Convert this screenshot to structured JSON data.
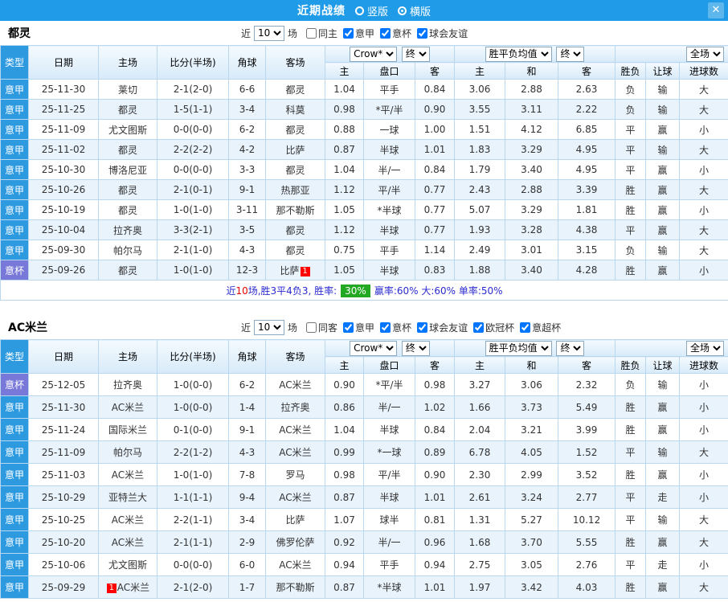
{
  "titlebar": {
    "title": "近期战绩",
    "vertical_label": "竖版",
    "horizontal_label": "横版",
    "selected_layout": "横版",
    "close_label": "✕"
  },
  "colors": {
    "titlebar_bg": "#1f9be7",
    "league_serie_a": "#2d9ae0",
    "league_cup": "#7878d8",
    "focus_team": "#009933",
    "win": "#e60000",
    "draw": "#2952cc",
    "loss": "#009933",
    "win_rate_badge_bg": "#22a822"
  },
  "sections": [
    {
      "team": "都灵",
      "near_label": "近",
      "count_value": "10",
      "games_label": "场",
      "filters": [
        {
          "label": "同主",
          "checked": false
        },
        {
          "label": "意甲",
          "checked": true
        },
        {
          "label": "意杯",
          "checked": true
        },
        {
          "label": "球会友谊",
          "checked": true
        }
      ],
      "header": {
        "type": "类型",
        "date": "日期",
        "home": "主场",
        "score": "比分(半场)",
        "corner": "角球",
        "away": "客场",
        "asia_select": "Crow*",
        "asia_final": "终",
        "asia_home": "主",
        "asia_handicap": "盘口",
        "asia_away": "客",
        "europe_select": "胜平负均值",
        "europe_final": "终",
        "europe_home": "主",
        "europe_draw": "和",
        "europe_away": "客",
        "scope_select": "全场",
        "wdl": "胜负",
        "handicap_result": "让球",
        "goals": "进球数"
      },
      "rows": [
        {
          "league": "意甲",
          "lgc": "jia",
          "date": "25-11-30",
          "home": "莱切",
          "hf": false,
          "score": "2-1(2-0)",
          "corner": "6-6",
          "away": "都灵",
          "af": true,
          "a1": "1.04",
          "hc": "平手",
          "hcr": false,
          "a3": "0.84",
          "e1": "3.06",
          "e2": "2.88",
          "e3": "2.63",
          "r1": "负",
          "c1": "g",
          "r2": "输",
          "c2": "g",
          "r3": "大",
          "c3": "r"
        },
        {
          "league": "意甲",
          "lgc": "jia",
          "date": "25-11-25",
          "home": "都灵",
          "hf": true,
          "score": "1-5(1-1)",
          "corner": "3-4",
          "away": "科莫",
          "af": false,
          "a1": "0.98",
          "hc": "*平/半",
          "hcr": true,
          "a3": "0.90",
          "e1": "3.55",
          "e2": "3.11",
          "e3": "2.22",
          "r1": "负",
          "c1": "g",
          "r2": "输",
          "c2": "g",
          "r3": "大",
          "c3": "r"
        },
        {
          "league": "意甲",
          "lgc": "jia",
          "date": "25-11-09",
          "home": "尤文图斯",
          "hf": false,
          "score": "0-0(0-0)",
          "corner": "6-2",
          "away": "都灵",
          "af": true,
          "a1": "0.88",
          "hc": "一球",
          "hcr": false,
          "a3": "1.00",
          "e1": "1.51",
          "e2": "4.12",
          "e3": "6.85",
          "r1": "平",
          "c1": "b",
          "r2": "赢",
          "c2": "r",
          "r3": "小",
          "c3": "b"
        },
        {
          "league": "意甲",
          "lgc": "jia",
          "date": "25-11-02",
          "home": "都灵",
          "hf": true,
          "score": "2-2(2-2)",
          "corner": "4-2",
          "away": "比萨",
          "af": false,
          "a1": "0.87",
          "hc": "半球",
          "hcr": false,
          "a3": "1.01",
          "e1": "1.83",
          "e2": "3.29",
          "e3": "4.95",
          "r1": "平",
          "c1": "b",
          "r2": "输",
          "c2": "g",
          "r3": "大",
          "c3": "r"
        },
        {
          "league": "意甲",
          "lgc": "jia",
          "date": "25-10-30",
          "home": "博洛尼亚",
          "hf": false,
          "score": "0-0(0-0)",
          "corner": "3-3",
          "away": "都灵",
          "af": true,
          "a1": "1.04",
          "hc": "半/一",
          "hcr": false,
          "a3": "0.84",
          "e1": "1.79",
          "e2": "3.40",
          "e3": "4.95",
          "r1": "平",
          "c1": "b",
          "r2": "赢",
          "c2": "r",
          "r3": "小",
          "c3": "b"
        },
        {
          "league": "意甲",
          "lgc": "jia",
          "date": "25-10-26",
          "home": "都灵",
          "hf": true,
          "score": "2-1(0-1)",
          "corner": "9-1",
          "away": "热那亚",
          "af": false,
          "a1": "1.12",
          "hc": "平/半",
          "hcr": false,
          "a3": "0.77",
          "e1": "2.43",
          "e2": "2.88",
          "e3": "3.39",
          "r1": "胜",
          "c1": "r",
          "r2": "赢",
          "c2": "r",
          "r3": "大",
          "c3": "r"
        },
        {
          "league": "意甲",
          "lgc": "jia",
          "date": "25-10-19",
          "home": "都灵",
          "hf": true,
          "score": "1-0(1-0)",
          "corner": "3-11",
          "away": "那不勒斯",
          "af": false,
          "a1": "1.05",
          "hc": "*半球",
          "hcr": true,
          "a3": "0.77",
          "e1": "5.07",
          "e2": "3.29",
          "e3": "1.81",
          "r1": "胜",
          "c1": "r",
          "r2": "赢",
          "c2": "r",
          "r3": "小",
          "c3": "b"
        },
        {
          "league": "意甲",
          "lgc": "jia",
          "date": "25-10-04",
          "home": "拉齐奥",
          "hf": false,
          "score": "3-3(2-1)",
          "corner": "3-5",
          "away": "都灵",
          "af": true,
          "a1": "1.12",
          "hc": "半球",
          "hcr": false,
          "a3": "0.77",
          "e1": "1.93",
          "e2": "3.28",
          "e3": "4.38",
          "r1": "平",
          "c1": "b",
          "r2": "赢",
          "c2": "r",
          "r3": "大",
          "c3": "r"
        },
        {
          "league": "意甲",
          "lgc": "jia",
          "date": "25-09-30",
          "home": "帕尔马",
          "hf": false,
          "score": "2-1(1-0)",
          "corner": "4-3",
          "away": "都灵",
          "af": true,
          "a1": "0.75",
          "hc": "平手",
          "hcr": false,
          "a3": "1.14",
          "e1": "2.49",
          "e2": "3.01",
          "e3": "3.15",
          "r1": "负",
          "c1": "g",
          "r2": "输",
          "c2": "g",
          "r3": "大",
          "c3": "r"
        },
        {
          "league": "意杯",
          "lgc": "bei",
          "date": "25-09-26",
          "home": "都灵",
          "hf": true,
          "score": "1-0(1-0)",
          "corner": "12-3",
          "away": "比萨",
          "af": false,
          "ab": "1",
          "abp": "after",
          "a1": "1.05",
          "hc": "半球",
          "hcr": false,
          "a3": "0.83",
          "e1": "1.88",
          "e2": "3.40",
          "e3": "4.28",
          "r1": "胜",
          "c1": "r",
          "r2": "赢",
          "c2": "r",
          "r3": "小",
          "c3": "b"
        }
      ],
      "summary": {
        "p1": "近",
        "n": "10",
        "p2": "场,胜3平4负3, 胜率:",
        "win_rate": "30%",
        "p3": "赢率:60% 大:60% 单率:50%"
      }
    },
    {
      "team": "AC米兰",
      "near_label": "近",
      "count_value": "10",
      "games_label": "场",
      "filters": [
        {
          "label": "同客",
          "checked": false
        },
        {
          "label": "意甲",
          "checked": true
        },
        {
          "label": "意杯",
          "checked": true
        },
        {
          "label": "球会友谊",
          "checked": true
        },
        {
          "label": "欧冠杯",
          "checked": true
        },
        {
          "label": "意超杯",
          "checked": true
        }
      ],
      "header": {
        "type": "类型",
        "date": "日期",
        "home": "主场",
        "score": "比分(半场)",
        "corner": "角球",
        "away": "客场",
        "asia_select": "Crow*",
        "asia_final": "终",
        "asia_home": "主",
        "asia_handicap": "盘口",
        "asia_away": "客",
        "europe_select": "胜平负均值",
        "europe_final": "终",
        "europe_home": "主",
        "europe_draw": "和",
        "europe_away": "客",
        "scope_select": "全场",
        "wdl": "胜负",
        "handicap_result": "让球",
        "goals": "进球数"
      },
      "rows": [
        {
          "league": "意杯",
          "lgc": "bei",
          "date": "25-12-05",
          "home": "拉齐奥",
          "hf": false,
          "score": "1-0(0-0)",
          "corner": "6-2",
          "away": "AC米兰",
          "af": true,
          "a1": "0.90",
          "hc": "*平/半",
          "hcr": true,
          "a3": "0.98",
          "e1": "3.27",
          "e2": "3.06",
          "e3": "2.32",
          "r1": "负",
          "c1": "g",
          "r2": "输",
          "c2": "g",
          "r3": "小",
          "c3": "b"
        },
        {
          "league": "意甲",
          "lgc": "jia",
          "date": "25-11-30",
          "home": "AC米兰",
          "hf": true,
          "score": "1-0(0-0)",
          "corner": "1-4",
          "away": "拉齐奥",
          "af": false,
          "a1": "0.86",
          "hc": "半/一",
          "hcr": false,
          "a3": "1.02",
          "e1": "1.66",
          "e2": "3.73",
          "e3": "5.49",
          "r1": "胜",
          "c1": "r",
          "r2": "赢",
          "c2": "r",
          "r3": "小",
          "c3": "b"
        },
        {
          "league": "意甲",
          "lgc": "jia",
          "date": "25-11-24",
          "home": "国际米兰",
          "hf": false,
          "score": "0-1(0-0)",
          "corner": "9-1",
          "away": "AC米兰",
          "af": true,
          "a1": "1.04",
          "hc": "半球",
          "hcr": false,
          "a3": "0.84",
          "e1": "2.04",
          "e2": "3.21",
          "e3": "3.99",
          "r1": "胜",
          "c1": "r",
          "r2": "赢",
          "c2": "r",
          "r3": "小",
          "c3": "b"
        },
        {
          "league": "意甲",
          "lgc": "jia",
          "date": "25-11-09",
          "home": "帕尔马",
          "hf": false,
          "score": "2-2(1-2)",
          "corner": "4-3",
          "away": "AC米兰",
          "af": true,
          "a1": "0.99",
          "hc": "*一球",
          "hcr": true,
          "a3": "0.89",
          "e1": "6.78",
          "e2": "4.05",
          "e3": "1.52",
          "r1": "平",
          "c1": "b",
          "r2": "输",
          "c2": "g",
          "r3": "大",
          "c3": "r"
        },
        {
          "league": "意甲",
          "lgc": "jia",
          "date": "25-11-03",
          "home": "AC米兰",
          "hf": true,
          "score": "1-0(1-0)",
          "corner": "7-8",
          "away": "罗马",
          "af": false,
          "a1": "0.98",
          "hc": "平/半",
          "hcr": false,
          "a3": "0.90",
          "e1": "2.30",
          "e2": "2.99",
          "e3": "3.52",
          "r1": "胜",
          "c1": "r",
          "r2": "赢",
          "c2": "r",
          "r3": "小",
          "c3": "b"
        },
        {
          "league": "意甲",
          "lgc": "jia",
          "date": "25-10-29",
          "home": "亚特兰大",
          "hf": false,
          "score": "1-1(1-1)",
          "corner": "9-4",
          "away": "AC米兰",
          "af": true,
          "a1": "0.87",
          "hc": "半球",
          "hcr": false,
          "a3": "1.01",
          "e1": "2.61",
          "e2": "3.24",
          "e3": "2.77",
          "r1": "平",
          "c1": "b",
          "r2": "走",
          "c2": "b",
          "r3": "小",
          "c3": "b"
        },
        {
          "league": "意甲",
          "lgc": "jia",
          "date": "25-10-25",
          "home": "AC米兰",
          "hf": true,
          "score": "2-2(1-1)",
          "corner": "3-4",
          "away": "比萨",
          "af": false,
          "a1": "1.07",
          "hc": "球半",
          "hcr": false,
          "a3": "0.81",
          "e1": "1.31",
          "e2": "5.27",
          "e3": "10.12",
          "r1": "平",
          "c1": "b",
          "r2": "输",
          "c2": "g",
          "r3": "大",
          "c3": "r"
        },
        {
          "league": "意甲",
          "lgc": "jia",
          "date": "25-10-20",
          "home": "AC米兰",
          "hf": true,
          "score": "2-1(1-1)",
          "corner": "2-9",
          "away": "佛罗伦萨",
          "af": false,
          "a1": "0.92",
          "hc": "半/一",
          "hcr": false,
          "a3": "0.96",
          "e1": "1.68",
          "e2": "3.70",
          "e3": "5.55",
          "r1": "胜",
          "c1": "r",
          "r2": "赢",
          "c2": "r",
          "r3": "大",
          "c3": "r"
        },
        {
          "league": "意甲",
          "lgc": "jia",
          "date": "25-10-06",
          "home": "尤文图斯",
          "hf": false,
          "score": "0-0(0-0)",
          "corner": "6-0",
          "away": "AC米兰",
          "af": true,
          "a1": "0.94",
          "hc": "平手",
          "hcr": false,
          "a3": "0.94",
          "e1": "2.75",
          "e2": "3.05",
          "e3": "2.76",
          "r1": "平",
          "c1": "b",
          "r2": "走",
          "c2": "b",
          "r3": "小",
          "c3": "b"
        },
        {
          "league": "意甲",
          "lgc": "jia",
          "date": "25-09-29",
          "home": "AC米兰",
          "hf": true,
          "hb": "1",
          "hbp": "before",
          "score": "2-1(2-0)",
          "corner": "1-7",
          "away": "那不勒斯",
          "af": false,
          "a1": "0.87",
          "hc": "*半球",
          "hcr": true,
          "a3": "1.01",
          "e1": "1.97",
          "e2": "3.42",
          "e3": "4.03",
          "r1": "胜",
          "c1": "r",
          "r2": "赢",
          "c2": "r",
          "r3": "大",
          "c3": "r"
        }
      ]
    }
  ]
}
